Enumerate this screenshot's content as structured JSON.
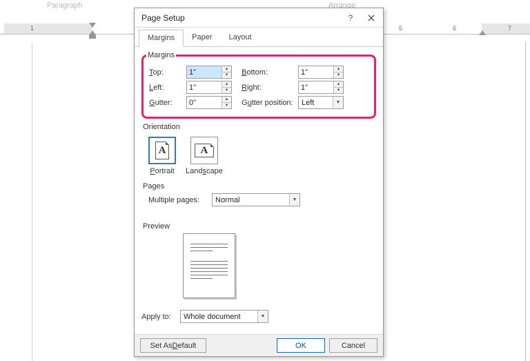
{
  "ribbon": {
    "paragraph_label": "Paragraph",
    "arrange_label": "Arrange"
  },
  "ruler": {
    "n1": "1",
    "n5": "5",
    "n6": "6",
    "n7": "7"
  },
  "dialog": {
    "title": "Page Setup",
    "tabs": {
      "margins": "Margins",
      "paper": "Paper",
      "layout": "Layout"
    },
    "margins": {
      "legend": "Margins",
      "top_label_pre": "T",
      "top_label_post": "op:",
      "bottom_label_pre": "B",
      "bottom_label_post": "ottom:",
      "left_label_pre": "L",
      "left_label_post": "eft:",
      "right_label_pre": "R",
      "right_label_post": "ight:",
      "gutter_label_pre": "G",
      "gutter_label_post": "utter:",
      "gutterpos_label_pre1": "G",
      "gutterpos_label_mid": "u",
      "gutterpos_label_post": "tter position:",
      "top": "1\"",
      "bottom": "1\"",
      "left": "1\"",
      "right": "1\"",
      "gutter": "0\"",
      "gutter_position": "Left"
    },
    "orientation": {
      "legend": "Orientation",
      "portrait_pre": "P",
      "portrait_post": "ortrait",
      "landscape_pre": "Land",
      "landscape_u": "s",
      "landscape_post": "cape"
    },
    "pages": {
      "legend": "Pages",
      "multiple_pre": "M",
      "multiple_post": "ultiple pages:",
      "multiple_value": "Normal"
    },
    "preview": {
      "legend": "Preview"
    },
    "apply_to": {
      "label_pre": "Appl",
      "label_u": "y",
      "label_post": " to:",
      "value": "Whole document"
    },
    "buttons": {
      "default_pre": "Set As ",
      "default_u": "D",
      "default_post": "efault",
      "ok": "OK",
      "cancel": "Cancel"
    }
  }
}
